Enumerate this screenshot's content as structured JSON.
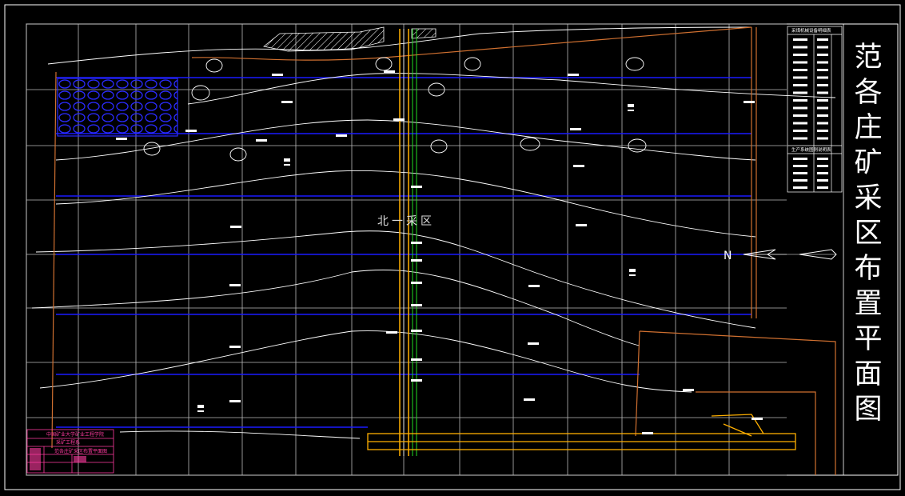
{
  "drawing": {
    "title_chars": [
      "范",
      "各",
      "庄",
      "矿",
      "采",
      "区",
      "布",
      "置",
      "平",
      "面",
      "图"
    ],
    "area_label": "北一采区",
    "north_label": "N",
    "legend_top_title": "采煤机械设备明细表",
    "legend_bottom_title": "生产系统图例说明表",
    "title_block": {
      "line1": "中国矿业大学矿业工程学院",
      "line2": "采矿工程系",
      "line3": "范各庄矿采区布置平面图"
    }
  },
  "colors": {
    "frame": "#ffffff",
    "roadway": "#1a1aff",
    "shaft": "#ffb000",
    "green": "#22dd22",
    "boundary": "#d07030",
    "tb": "#ff3aa0"
  }
}
